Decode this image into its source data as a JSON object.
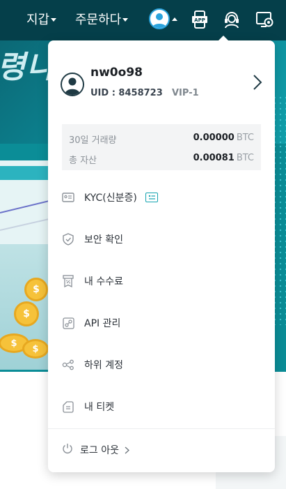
{
  "topbar": {
    "wallet_label": "지갑",
    "order_label": "주문하다",
    "icons": [
      "user-avatar-icon",
      "app-download-icon",
      "support-icon",
      "settings-icon"
    ],
    "app_icon_text": "APP"
  },
  "banner": {
    "text": "령나"
  },
  "coins": {
    "symbol": "$"
  },
  "user": {
    "username": "nw0o98",
    "uid": "UID : 8458723",
    "vip": "VIP-1"
  },
  "stats": {
    "volume_label": "30일 거래량",
    "volume_value": "0.00000",
    "volume_unit": "BTC",
    "assets_label": "총 자산",
    "assets_value": "0.00081",
    "assets_unit": "BTC"
  },
  "menu": [
    {
      "label": "KYC(신분증)",
      "icon": "id-card-icon"
    },
    {
      "label": "보안 확인",
      "icon": "shield-check-icon"
    },
    {
      "label": "내 수수료",
      "icon": "fee-receipt-icon"
    },
    {
      "label": "API 관리",
      "icon": "api-link-icon"
    },
    {
      "label": "하위 계정",
      "icon": "sub-account-icon"
    },
    {
      "label": "내 티켓",
      "icon": "ticket-icon"
    }
  ],
  "logout": {
    "label": "로그 아웃"
  },
  "colors": {
    "topbar": "#053f4a",
    "accent": "#14a3b0",
    "banner": "#0b8d97",
    "coin": "#f6c23a"
  }
}
